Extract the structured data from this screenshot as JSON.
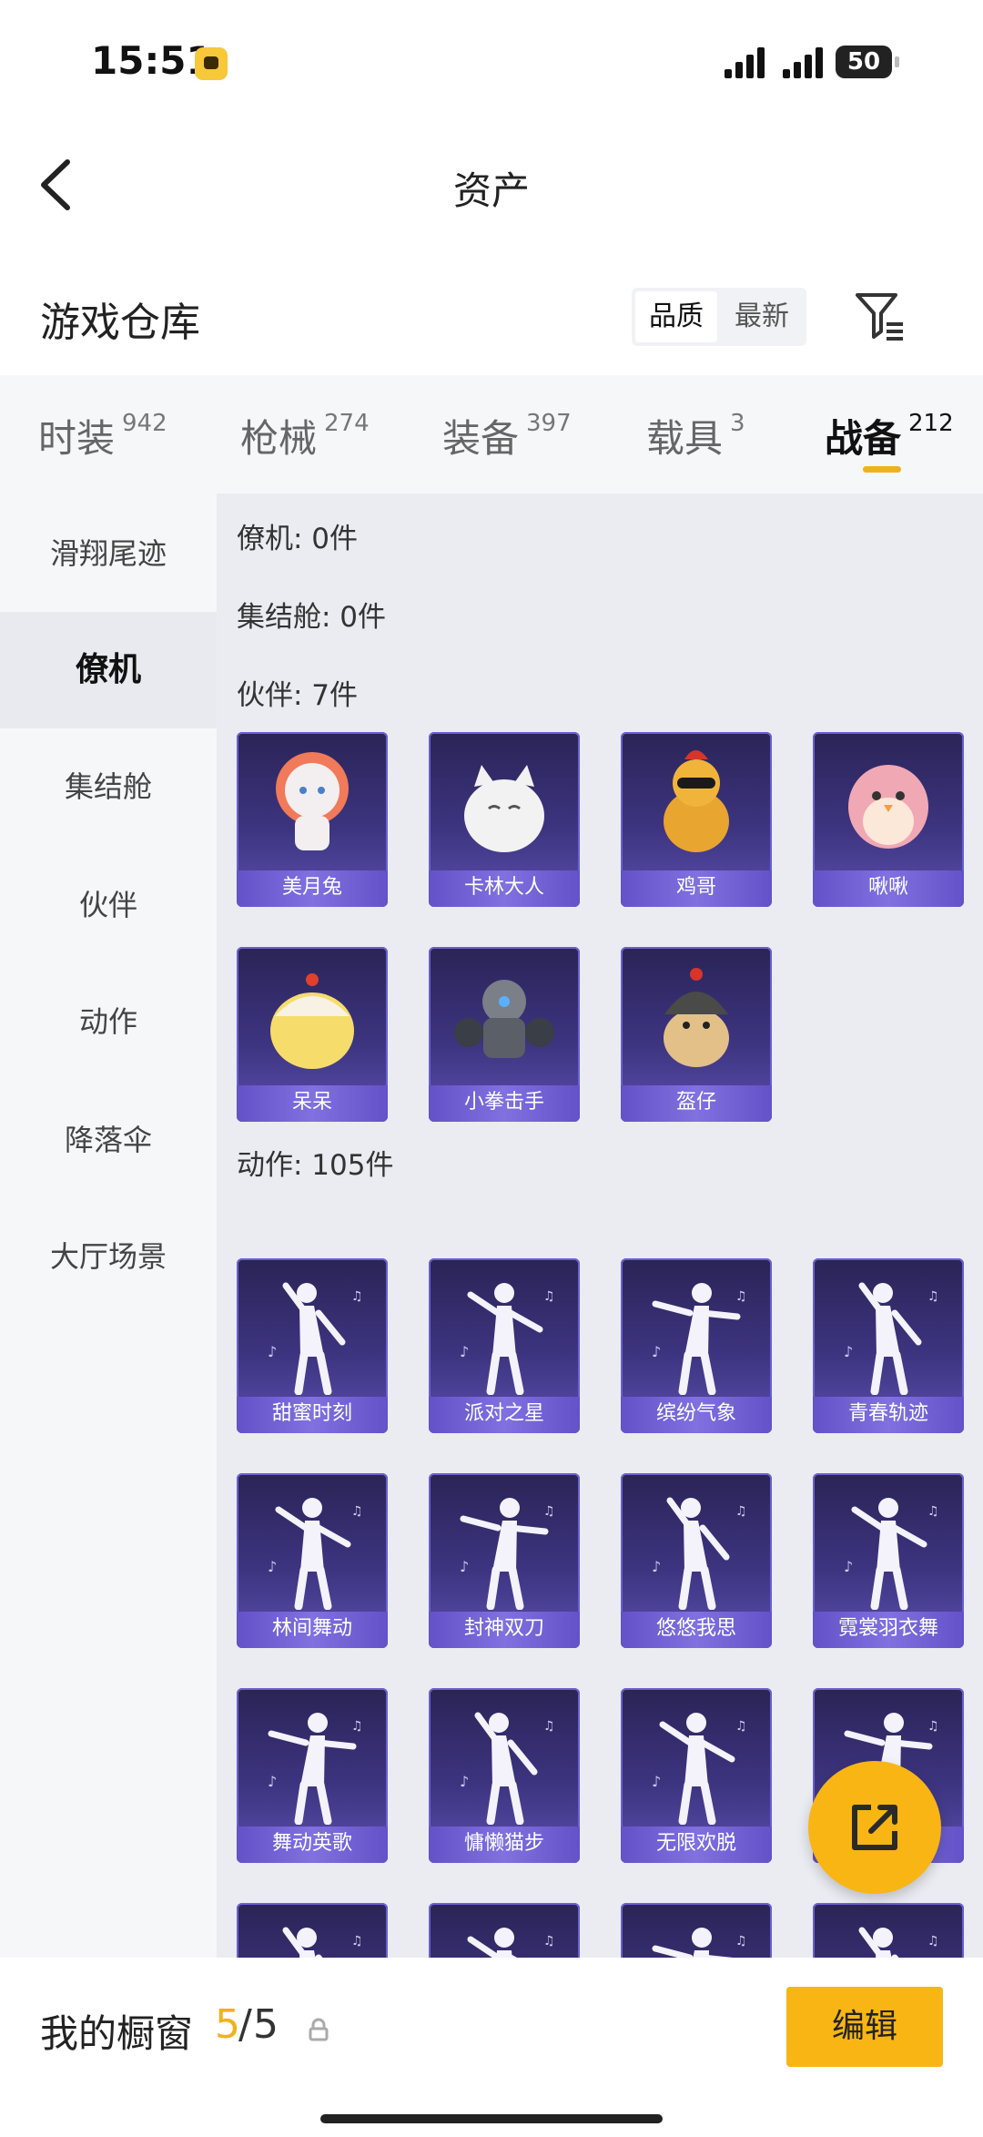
{
  "status_bar": {
    "time": "15:51",
    "battery": "50"
  },
  "header": {
    "title": "资产"
  },
  "warehouse": {
    "title": "游戏仓库",
    "sort_options": [
      "品质",
      "最新"
    ],
    "sort_selected": "品质"
  },
  "tabs": [
    {
      "label": "时装",
      "count": "942"
    },
    {
      "label": "枪械",
      "count": "274"
    },
    {
      "label": "装备",
      "count": "397"
    },
    {
      "label": "载具",
      "count": "3"
    },
    {
      "label": "战备",
      "count": "212"
    }
  ],
  "active_tab": "战备",
  "sidebar": {
    "items": [
      {
        "label": "滑翔尾迹"
      },
      {
        "label": "僚机"
      },
      {
        "label": "集结舱"
      },
      {
        "label": "伙伴"
      },
      {
        "label": "动作"
      },
      {
        "label": "降落伞"
      },
      {
        "label": "大厅场景"
      }
    ],
    "active": "僚机"
  },
  "sections": {
    "wingman": "僚机: 0件",
    "capsule": "集结舱: 0件",
    "partner": "伙伴: 7件",
    "action": "动作: 105件"
  },
  "partners": [
    {
      "name": "美月兔"
    },
    {
      "name": "卡林大人"
    },
    {
      "name": "鸡哥"
    },
    {
      "name": "啾啾"
    },
    {
      "name": "呆呆"
    },
    {
      "name": "小拳击手"
    },
    {
      "name": "盔仔"
    }
  ],
  "actions": [
    {
      "name": "甜蜜时刻"
    },
    {
      "name": "派对之星"
    },
    {
      "name": "缤纷气象"
    },
    {
      "name": "青春轨迹"
    },
    {
      "name": "林间舞动"
    },
    {
      "name": "封神双刀"
    },
    {
      "name": "悠悠我思"
    },
    {
      "name": "霓裳羽衣舞"
    },
    {
      "name": "舞动英歌"
    },
    {
      "name": "慵懒猫步"
    },
    {
      "name": "无限欢脱"
    },
    {
      "name": ""
    },
    {
      "name": ""
    },
    {
      "name": ""
    },
    {
      "name": ""
    },
    {
      "name": ""
    }
  ],
  "showcase": {
    "label": "我的橱窗",
    "used": "5",
    "separator": "/",
    "total": "5",
    "edit_label": "编辑"
  },
  "colors": {
    "accent": "#f8b514",
    "card_top": "#2a2456",
    "card_bottom": "#5b4fae",
    "label_bar": "#7465d8"
  }
}
